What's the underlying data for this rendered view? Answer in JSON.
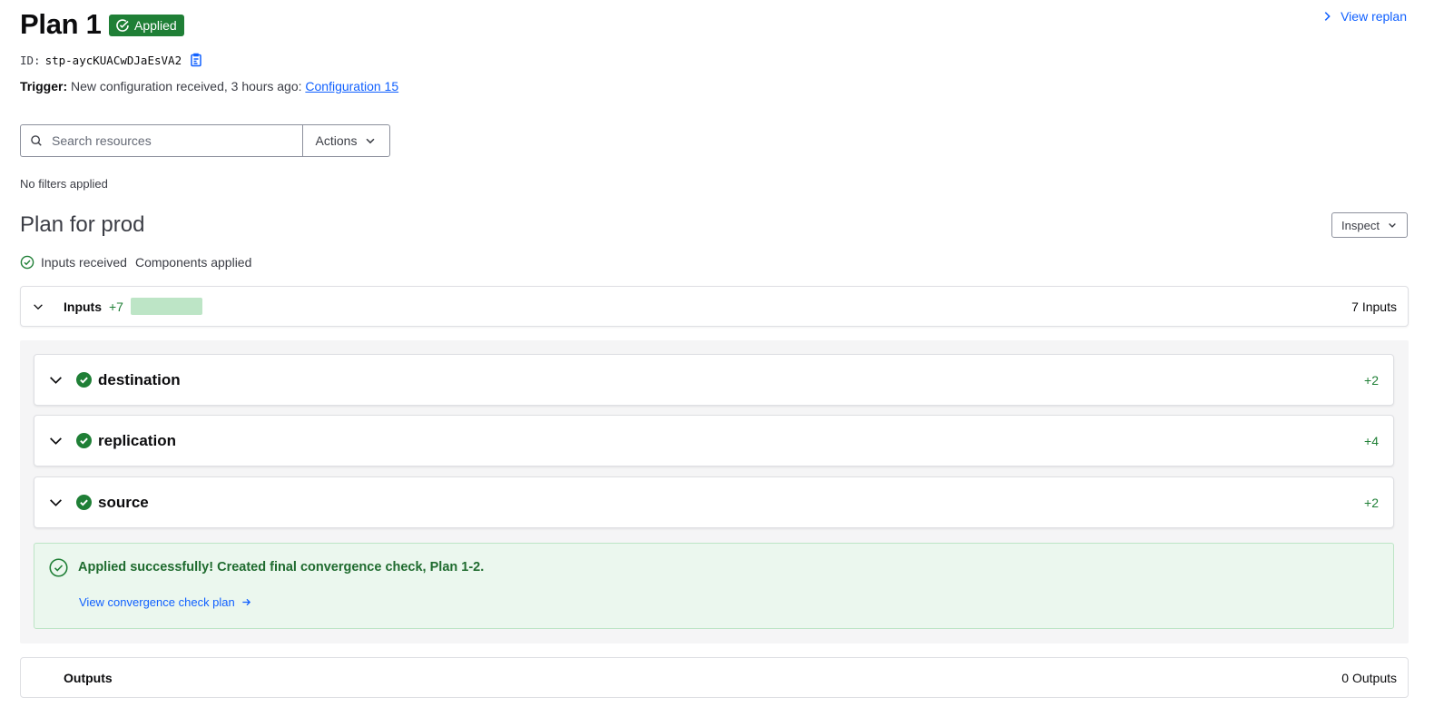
{
  "header": {
    "title": "Plan 1",
    "badge": "Applied",
    "replan_link": "View replan",
    "id_label": "ID:",
    "id_value": "stp-aycKUACwDJaEsVA2",
    "trigger_label": "Trigger:",
    "trigger_text": "New configuration received, 3 hours ago:",
    "trigger_link": "Configuration 15"
  },
  "search": {
    "placeholder": "Search resources",
    "value": "",
    "actions_label": "Actions"
  },
  "filters_text": "No filters applied",
  "plan": {
    "heading": "Plan for prod",
    "inspect_label": "Inspect",
    "status_inputs": "Inputs received",
    "status_components": "Components applied"
  },
  "inputs_row": {
    "label": "Inputs",
    "count": "+7",
    "summary": "7 Inputs"
  },
  "components": [
    {
      "name": "destination",
      "count": "+2"
    },
    {
      "name": "replication",
      "count": "+4"
    },
    {
      "name": "source",
      "count": "+2"
    }
  ],
  "success": {
    "message": "Applied successfully! Created final convergence check, Plan 1-2.",
    "link": "View convergence check plan"
  },
  "outputs_row": {
    "label": "Outputs",
    "summary": "0 Outputs"
  },
  "colors": {
    "accent_link": "#1060ff",
    "success_green": "#1f7f36",
    "success_bg": "#ebf7ee",
    "panel_bg": "#f5f5f6"
  },
  "icons": {
    "badge": "check-circle-icon",
    "replan": "chevron-right-icon",
    "copy": "clipboard-copy-icon",
    "search": "search-icon",
    "dropdown": "chevron-down-icon",
    "component_status": "check-circle-filled-icon",
    "success": "check-circle-outline-icon",
    "link_arrow": "arrow-right-icon"
  }
}
